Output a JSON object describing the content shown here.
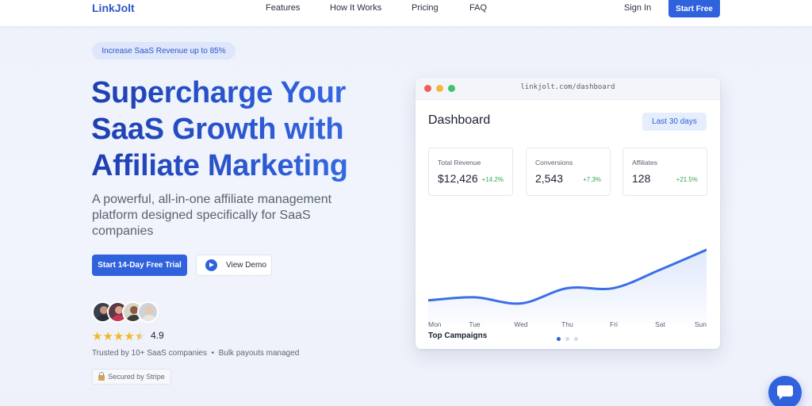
{
  "nav": {
    "logo": "LinkJolt",
    "links": [
      "Features",
      "How It Works",
      "Pricing",
      "FAQ"
    ],
    "signin": "Sign In",
    "start_free": "Start Free"
  },
  "hero": {
    "badge": "Increase SaaS Revenue up to 85%",
    "headline_lines": [
      "Supercharge Your",
      "SaaS Growth with",
      "Affiliate Marketing"
    ],
    "subheadline": "A powerful, all-in-one affiliate management platform designed specifically for SaaS companies",
    "cta_primary": "Start 14-Day Free Trial",
    "cta_demo": "View Demo",
    "rating": "4.9",
    "rating_stars": 4.5,
    "trusted_text": "Trusted by 10+ SaaS companies  •  Bulk payouts managed",
    "secured_text": "Secured by Stripe"
  },
  "dashboard": {
    "url": "linkjolt.com/dashboard",
    "title": "Dashboard",
    "range_label": "Last 30 days",
    "metrics": [
      {
        "label": "Total Revenue",
        "value": "$12,426",
        "delta": "+14.2%"
      },
      {
        "label": "Conversions",
        "value": "2,543",
        "delta": "+7.3%"
      },
      {
        "label": "Affiliates",
        "value": "128",
        "delta": "+21.5%"
      }
    ],
    "section_label": "Top Campaigns"
  },
  "colors": {
    "accent": "#2f62dc",
    "positive": "#36a45c",
    "star": "#f2b823"
  },
  "chart_data": {
    "type": "area",
    "categories": [
      "Mon",
      "Tue",
      "Wed",
      "Thu",
      "Fri",
      "Sat",
      "Sun"
    ],
    "series": [
      {
        "values": [
          1.2,
          1.4,
          1.0,
          2.0,
          2.0,
          3.2,
          4.5
        ]
      }
    ],
    "ylim": [
      0,
      6
    ],
    "grid": false
  }
}
